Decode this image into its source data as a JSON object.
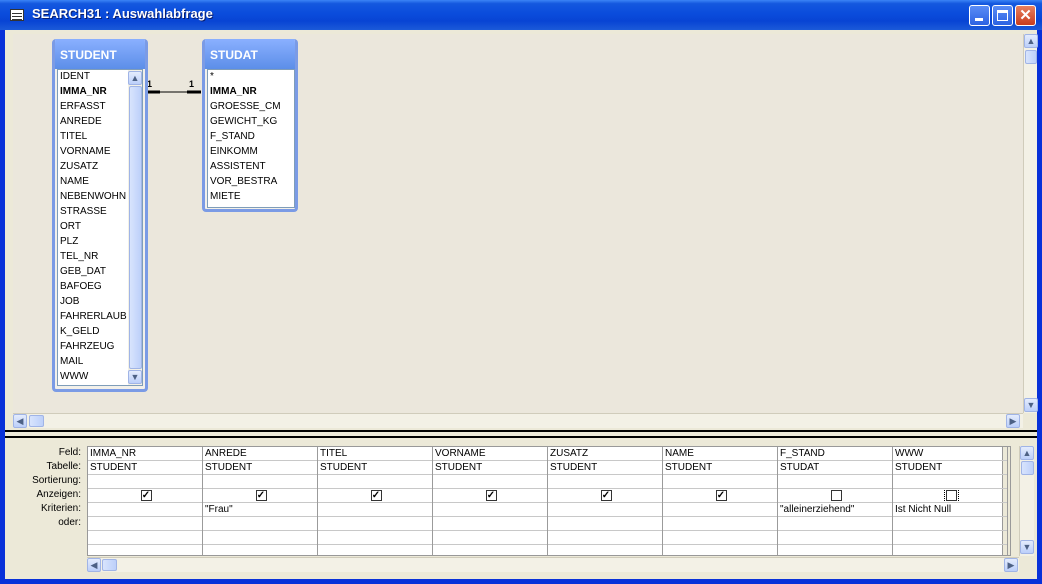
{
  "window": {
    "title": "SEARCH31 : Auswahlabfrage",
    "close_glyph": "✕"
  },
  "tables": {
    "student": {
      "name": "STUDENT",
      "fields": [
        "IDENT",
        "IMMA_NR",
        "ERFASST",
        "ANREDE",
        "TITEL",
        "VORNAME",
        "ZUSATZ",
        "NAME",
        "NEBENWOHN",
        "STRASSE",
        "ORT",
        "PLZ",
        "TEL_NR",
        "GEB_DAT",
        "BAFOEG",
        "JOB",
        "FAHRERLAUB",
        "K_GELD",
        "FAHRZEUG",
        "MAIL",
        "WWW"
      ]
    },
    "studat": {
      "name": "STUDAT",
      "fields": [
        "*",
        "IMMA_NR",
        "GROESSE_CM",
        "GEWICHT_KG",
        "F_STAND",
        "EINKOMM",
        "ASSISTENT",
        "VOR_BESTRA",
        "MIETE"
      ]
    }
  },
  "relationship": {
    "left_label": "1",
    "right_label": "1"
  },
  "grid": {
    "row_labels": [
      "Feld:",
      "Tabelle:",
      "Sortierung:",
      "Anzeigen:",
      "Kriterien:",
      "oder:"
    ],
    "columns": [
      {
        "field": "IMMA_NR",
        "table": "STUDENT",
        "sort": "",
        "show": true,
        "criteria": "",
        "or": ""
      },
      {
        "field": "ANREDE",
        "table": "STUDENT",
        "sort": "",
        "show": true,
        "criteria": "\"Frau\"",
        "or": ""
      },
      {
        "field": "TITEL",
        "table": "STUDENT",
        "sort": "",
        "show": true,
        "criteria": "",
        "or": ""
      },
      {
        "field": "VORNAME",
        "table": "STUDENT",
        "sort": "",
        "show": true,
        "criteria": "",
        "or": ""
      },
      {
        "field": "ZUSATZ",
        "table": "STUDENT",
        "sort": "",
        "show": true,
        "criteria": "",
        "or": ""
      },
      {
        "field": "NAME",
        "table": "STUDENT",
        "sort": "",
        "show": true,
        "criteria": "",
        "or": ""
      },
      {
        "field": "F_STAND",
        "table": "STUDAT",
        "sort": "",
        "show": false,
        "criteria": "\"alleinerziehend\"",
        "or": ""
      },
      {
        "field": "WWW",
        "table": "STUDENT",
        "sort": "",
        "show": false,
        "criteria": "Ist Nicht Null",
        "or": ""
      }
    ],
    "check_glyph": "✓"
  },
  "scroll_glyphs": {
    "up": "▲",
    "down": "▼",
    "left": "◀",
    "right": "▶"
  }
}
